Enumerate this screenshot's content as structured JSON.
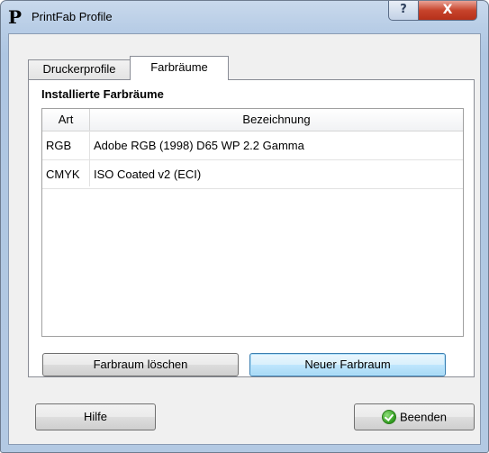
{
  "window": {
    "title": "PrintFab Profile",
    "app_icon_glyph": "P",
    "help_glyph": "?",
    "close_glyph": "X"
  },
  "tabs": [
    {
      "label": "Druckerprofile",
      "active": false
    },
    {
      "label": "Farbräume",
      "active": true
    }
  ],
  "panel": {
    "heading": "Installierte Farbräume",
    "table": {
      "columns": [
        "Art",
        "Bezeichnung"
      ],
      "rows": [
        {
          "art": "RGB",
          "bezeichnung": "Adobe RGB (1998) D65 WP 2.2 Gamma"
        },
        {
          "art": "CMYK",
          "bezeichnung": "ISO Coated v2 (ECI)"
        }
      ]
    },
    "buttons": {
      "delete": "Farbraum löschen",
      "new": "Neuer Farbraum"
    }
  },
  "footer": {
    "help": "Hilfe",
    "quit": "Beenden",
    "quit_icon": "ok-check-icon"
  },
  "colors": {
    "title_bar": "#b8cde6",
    "close_button": "#c7442c",
    "focus_button": "#3c7fb1"
  }
}
